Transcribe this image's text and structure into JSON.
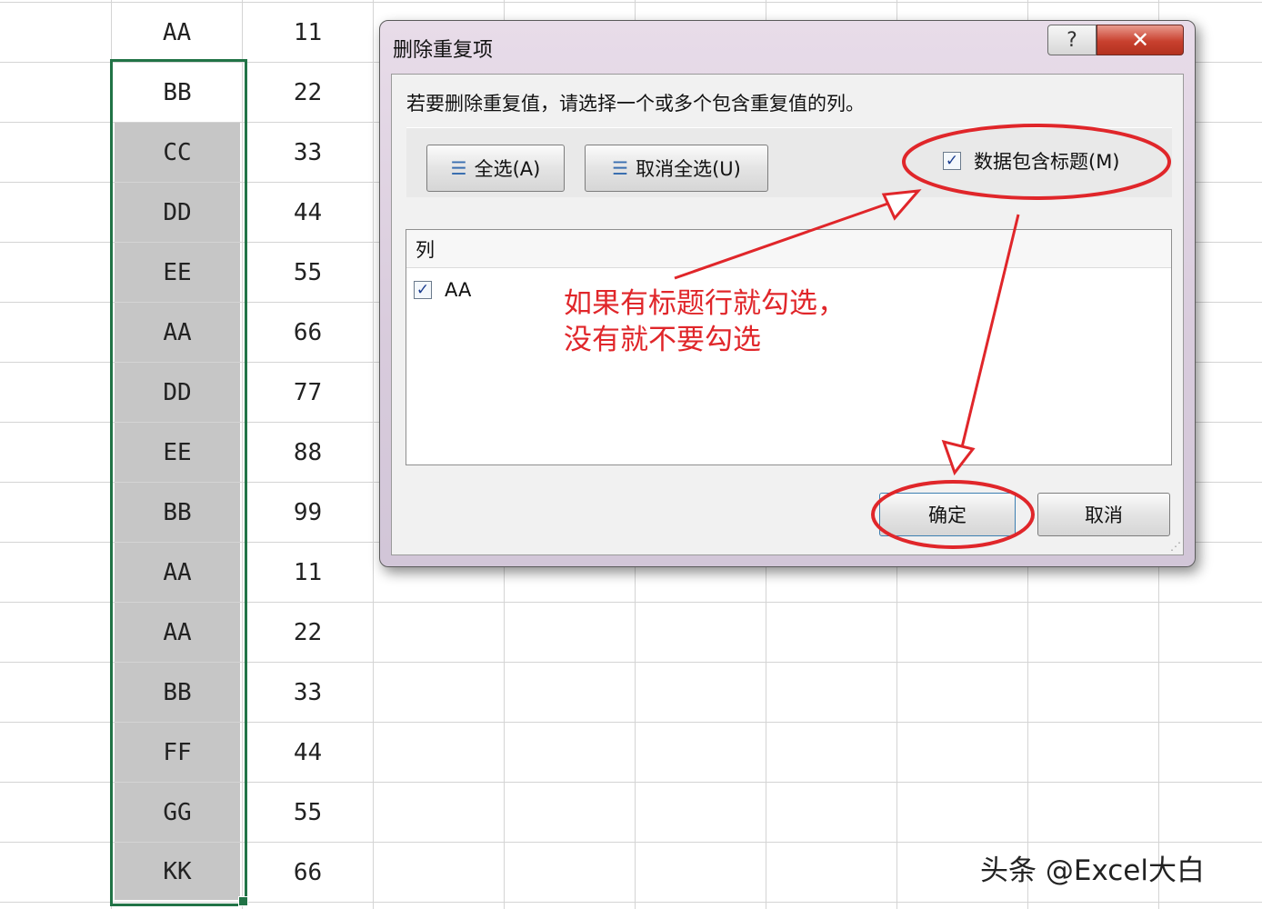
{
  "sheet": {
    "rows": [
      {
        "a": "AA",
        "b": "11"
      },
      {
        "a": "BB",
        "b": "22"
      },
      {
        "a": "CC",
        "b": "33"
      },
      {
        "a": "DD",
        "b": "44"
      },
      {
        "a": "EE",
        "b": "55"
      },
      {
        "a": "AA",
        "b": "66"
      },
      {
        "a": "DD",
        "b": "77"
      },
      {
        "a": "EE",
        "b": "88"
      },
      {
        "a": "BB",
        "b": "99"
      },
      {
        "a": "AA",
        "b": "11"
      },
      {
        "a": "AA",
        "b": "22"
      },
      {
        "a": "BB",
        "b": "33"
      },
      {
        "a": "FF",
        "b": "44"
      },
      {
        "a": "GG",
        "b": "55"
      },
      {
        "a": "KK",
        "b": "66"
      }
    ]
  },
  "dialog": {
    "title": "删除重复项",
    "help_label": "?",
    "close_label": "✕",
    "instruction": "若要删除重复值，请选择一个或多个包含重复值的列。",
    "select_all_label": "全选(A)",
    "unselect_all_label": "取消全选(U)",
    "header_checkbox_label": "数据包含标题(M)",
    "header_checkbox_checked": true,
    "columns_header": "列",
    "columns": [
      {
        "label": "AA",
        "checked": true
      }
    ],
    "ok_label": "确定",
    "cancel_label": "取消"
  },
  "annotation": {
    "text": "如果有标题行就勾选，\n没有就不要勾选",
    "color": "#e0262a"
  },
  "watermark": "头条 @Excel大白",
  "colors": {
    "selection_border": "#217346",
    "selected_fill": "#c6c6c6",
    "close_button": "#c8402e"
  }
}
